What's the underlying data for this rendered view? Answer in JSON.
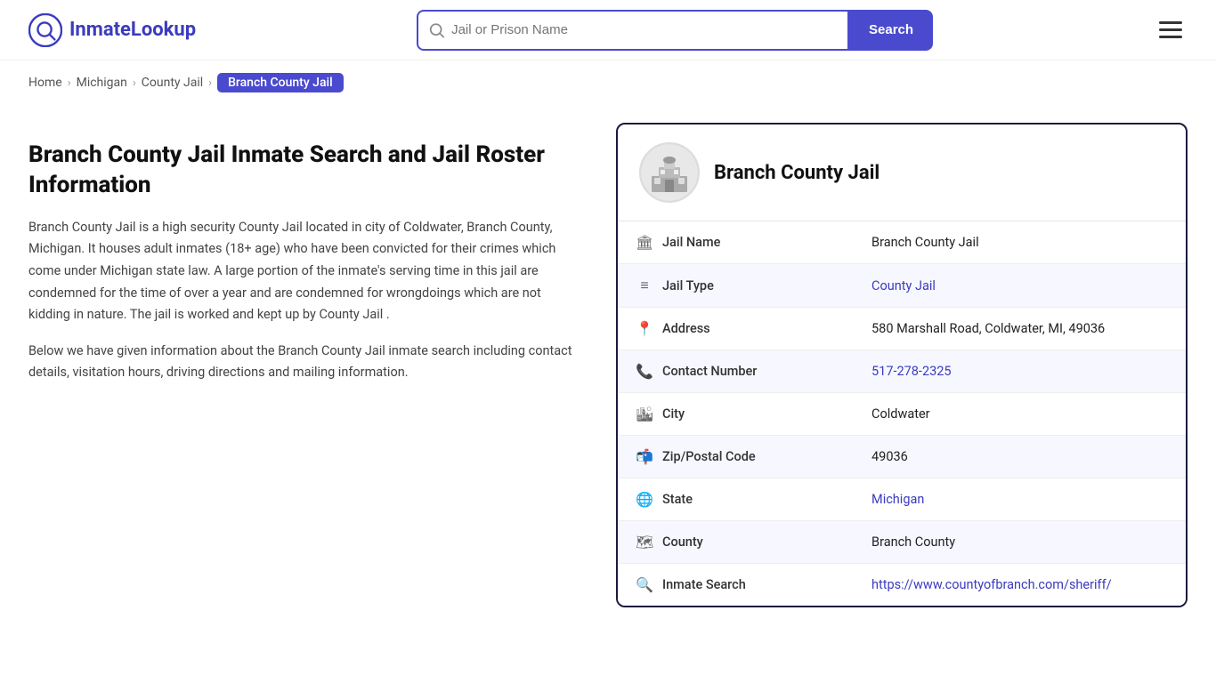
{
  "logo": {
    "text_inmate": "Inmate",
    "text_lookup": "Lookup",
    "icon_label": "inmate-lookup-logo"
  },
  "header": {
    "search_placeholder": "Jail or Prison Name",
    "search_button_label": "Search"
  },
  "breadcrumb": {
    "items": [
      {
        "label": "Home",
        "href": "#",
        "active": false
      },
      {
        "label": "Michigan",
        "href": "#",
        "active": false
      },
      {
        "label": "County Jail",
        "href": "#",
        "active": false
      },
      {
        "label": "Branch County Jail",
        "href": "#",
        "active": true
      }
    ]
  },
  "left": {
    "title": "Branch County Jail Inmate Search and Jail Roster Information",
    "desc1": "Branch County Jail is a high security County Jail located in city of Coldwater, Branch County, Michigan. It houses adult inmates (18+ age) who have been convicted for their crimes which come under Michigan state law. A large portion of the inmate's serving time in this jail are condemned for the time of over a year and are condemned for wrongdoings which are not kidding in nature. The jail is worked and kept up by County Jail .",
    "desc2": "Below we have given information about the Branch County Jail inmate search including contact details, visitation hours, driving directions and mailing information."
  },
  "card": {
    "title": "Branch County Jail",
    "rows": [
      {
        "icon": "🏛",
        "label": "Jail Name",
        "value": "Branch County Jail",
        "type": "text"
      },
      {
        "icon": "≡",
        "label": "Jail Type",
        "value": "County Jail",
        "type": "link",
        "href": "#"
      },
      {
        "icon": "📍",
        "label": "Address",
        "value": "580 Marshall Road, Coldwater, MI, 49036",
        "type": "text"
      },
      {
        "icon": "📞",
        "label": "Contact Number",
        "value": "517-278-2325",
        "type": "link",
        "href": "tel:5172782325"
      },
      {
        "icon": "🏙",
        "label": "City",
        "value": "Coldwater",
        "type": "text"
      },
      {
        "icon": "📬",
        "label": "Zip/Postal Code",
        "value": "49036",
        "type": "text"
      },
      {
        "icon": "🌐",
        "label": "State",
        "value": "Michigan",
        "type": "link",
        "href": "#"
      },
      {
        "icon": "🗺",
        "label": "County",
        "value": "Branch County",
        "type": "text"
      },
      {
        "icon": "🔍",
        "label": "Inmate Search",
        "value": "https://www.countyofbranch.com/sheriff/",
        "type": "link",
        "href": "https://www.countyofbranch.com/sheriff/"
      }
    ]
  }
}
